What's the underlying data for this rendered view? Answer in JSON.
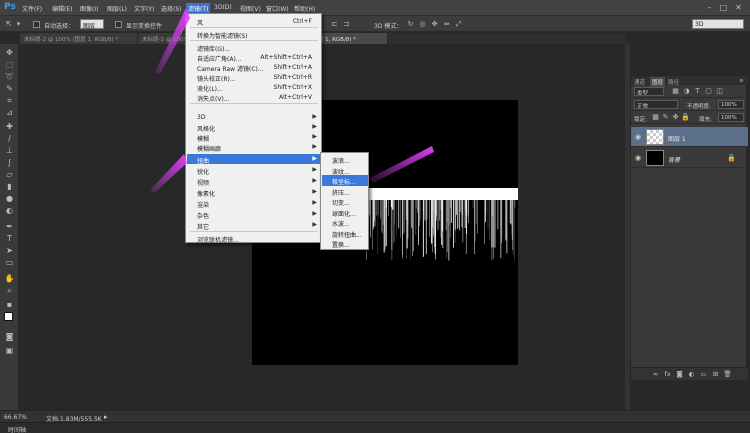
{
  "app": {
    "logo": "Ps",
    "menu": [
      {
        "label": "文件(F)"
      },
      {
        "label": "编辑(E)"
      },
      {
        "label": "图像(I)"
      },
      {
        "label": "图层(L)"
      },
      {
        "label": "文字(Y)"
      },
      {
        "label": "选择(S)"
      },
      {
        "label": "滤镜(T)"
      },
      {
        "label": "3D(D)"
      },
      {
        "label": "视图(V)"
      },
      {
        "label": "窗口(W)"
      },
      {
        "label": "帮助(H)"
      }
    ],
    "window_buttons": {
      "minimize": "–",
      "restore": "□",
      "close": "✕"
    }
  },
  "options_bar": {
    "auto_select_label": "自动选择：",
    "auto_select_value": "图层",
    "show_transform_label": "显示变换控件",
    "mode_3d_label": "3D 模式：",
    "workspace_select": "3D"
  },
  "tabs": [
    {
      "label": "未标题-2 @ 100% (图层 1, RGB/8) *",
      "active": false
    },
    {
      "label": "未标题-2 @ 100% (矩形 1, RGB/8) *",
      "active": false
    },
    {
      "label": "未标题-1 @ 66.7% (图层 1, RGB/8) *",
      "active": true
    }
  ],
  "status_bar": {
    "zoom": "66.67%",
    "doc_info": "文档:1.83M/555.5K",
    "bottom_label": "时间轴"
  },
  "layers_panel": {
    "tabs": [
      {
        "label": "通道"
      },
      {
        "label": "图层"
      },
      {
        "label": "路径"
      }
    ],
    "kind_filter": "类型",
    "blend_mode": "正常",
    "opacity_label": "不透明度:",
    "opacity_value": "100%",
    "lock_label": "锁定:",
    "fill_label": "填充:",
    "fill_value": "100%",
    "layers": [
      {
        "name": "图层 1",
        "selected": true
      },
      {
        "name": "背景",
        "selected": false
      }
    ]
  },
  "filter_menu": {
    "items": [
      {
        "label": "风",
        "shortcut": "Ctrl+F"
      },
      {
        "label": "转换为智能滤镜(S)",
        "shortcut": ""
      },
      {
        "label": "滤镜库(G)...",
        "shortcut": ""
      },
      {
        "label": "自适应广角(A)...",
        "shortcut": "Alt+Shift+Ctrl+A"
      },
      {
        "label": "Camera Raw 滤镜(C)...",
        "shortcut": "Shift+Ctrl+A"
      },
      {
        "label": "镜头校正(R)...",
        "shortcut": "Shift+Ctrl+R"
      },
      {
        "label": "液化(L)...",
        "shortcut": "Shift+Ctrl+X"
      },
      {
        "label": "消失点(V)...",
        "shortcut": "Alt+Ctrl+V"
      },
      {
        "label": "3D"
      },
      {
        "label": "风格化"
      },
      {
        "label": "模糊"
      },
      {
        "label": "模糊画廊"
      },
      {
        "label": "扭曲"
      },
      {
        "label": "锐化"
      },
      {
        "label": "视频"
      },
      {
        "label": "像素化"
      },
      {
        "label": "渲染"
      },
      {
        "label": "杂色"
      },
      {
        "label": "其它"
      },
      {
        "label": "浏览联机滤镜..."
      }
    ]
  },
  "distort_submenu": {
    "items": [
      {
        "label": "波浪..."
      },
      {
        "label": "波纹..."
      },
      {
        "label": "极坐标..."
      },
      {
        "label": "挤压..."
      },
      {
        "label": "切变..."
      },
      {
        "label": "球面化..."
      },
      {
        "label": "水波..."
      },
      {
        "label": "旋转扭曲..."
      },
      {
        "label": "置换..."
      }
    ]
  },
  "colors": {
    "menu_highlight": "#3b79d8",
    "annotation_arrow": "#e040fb",
    "ps_blue": "#3aa0e6"
  }
}
